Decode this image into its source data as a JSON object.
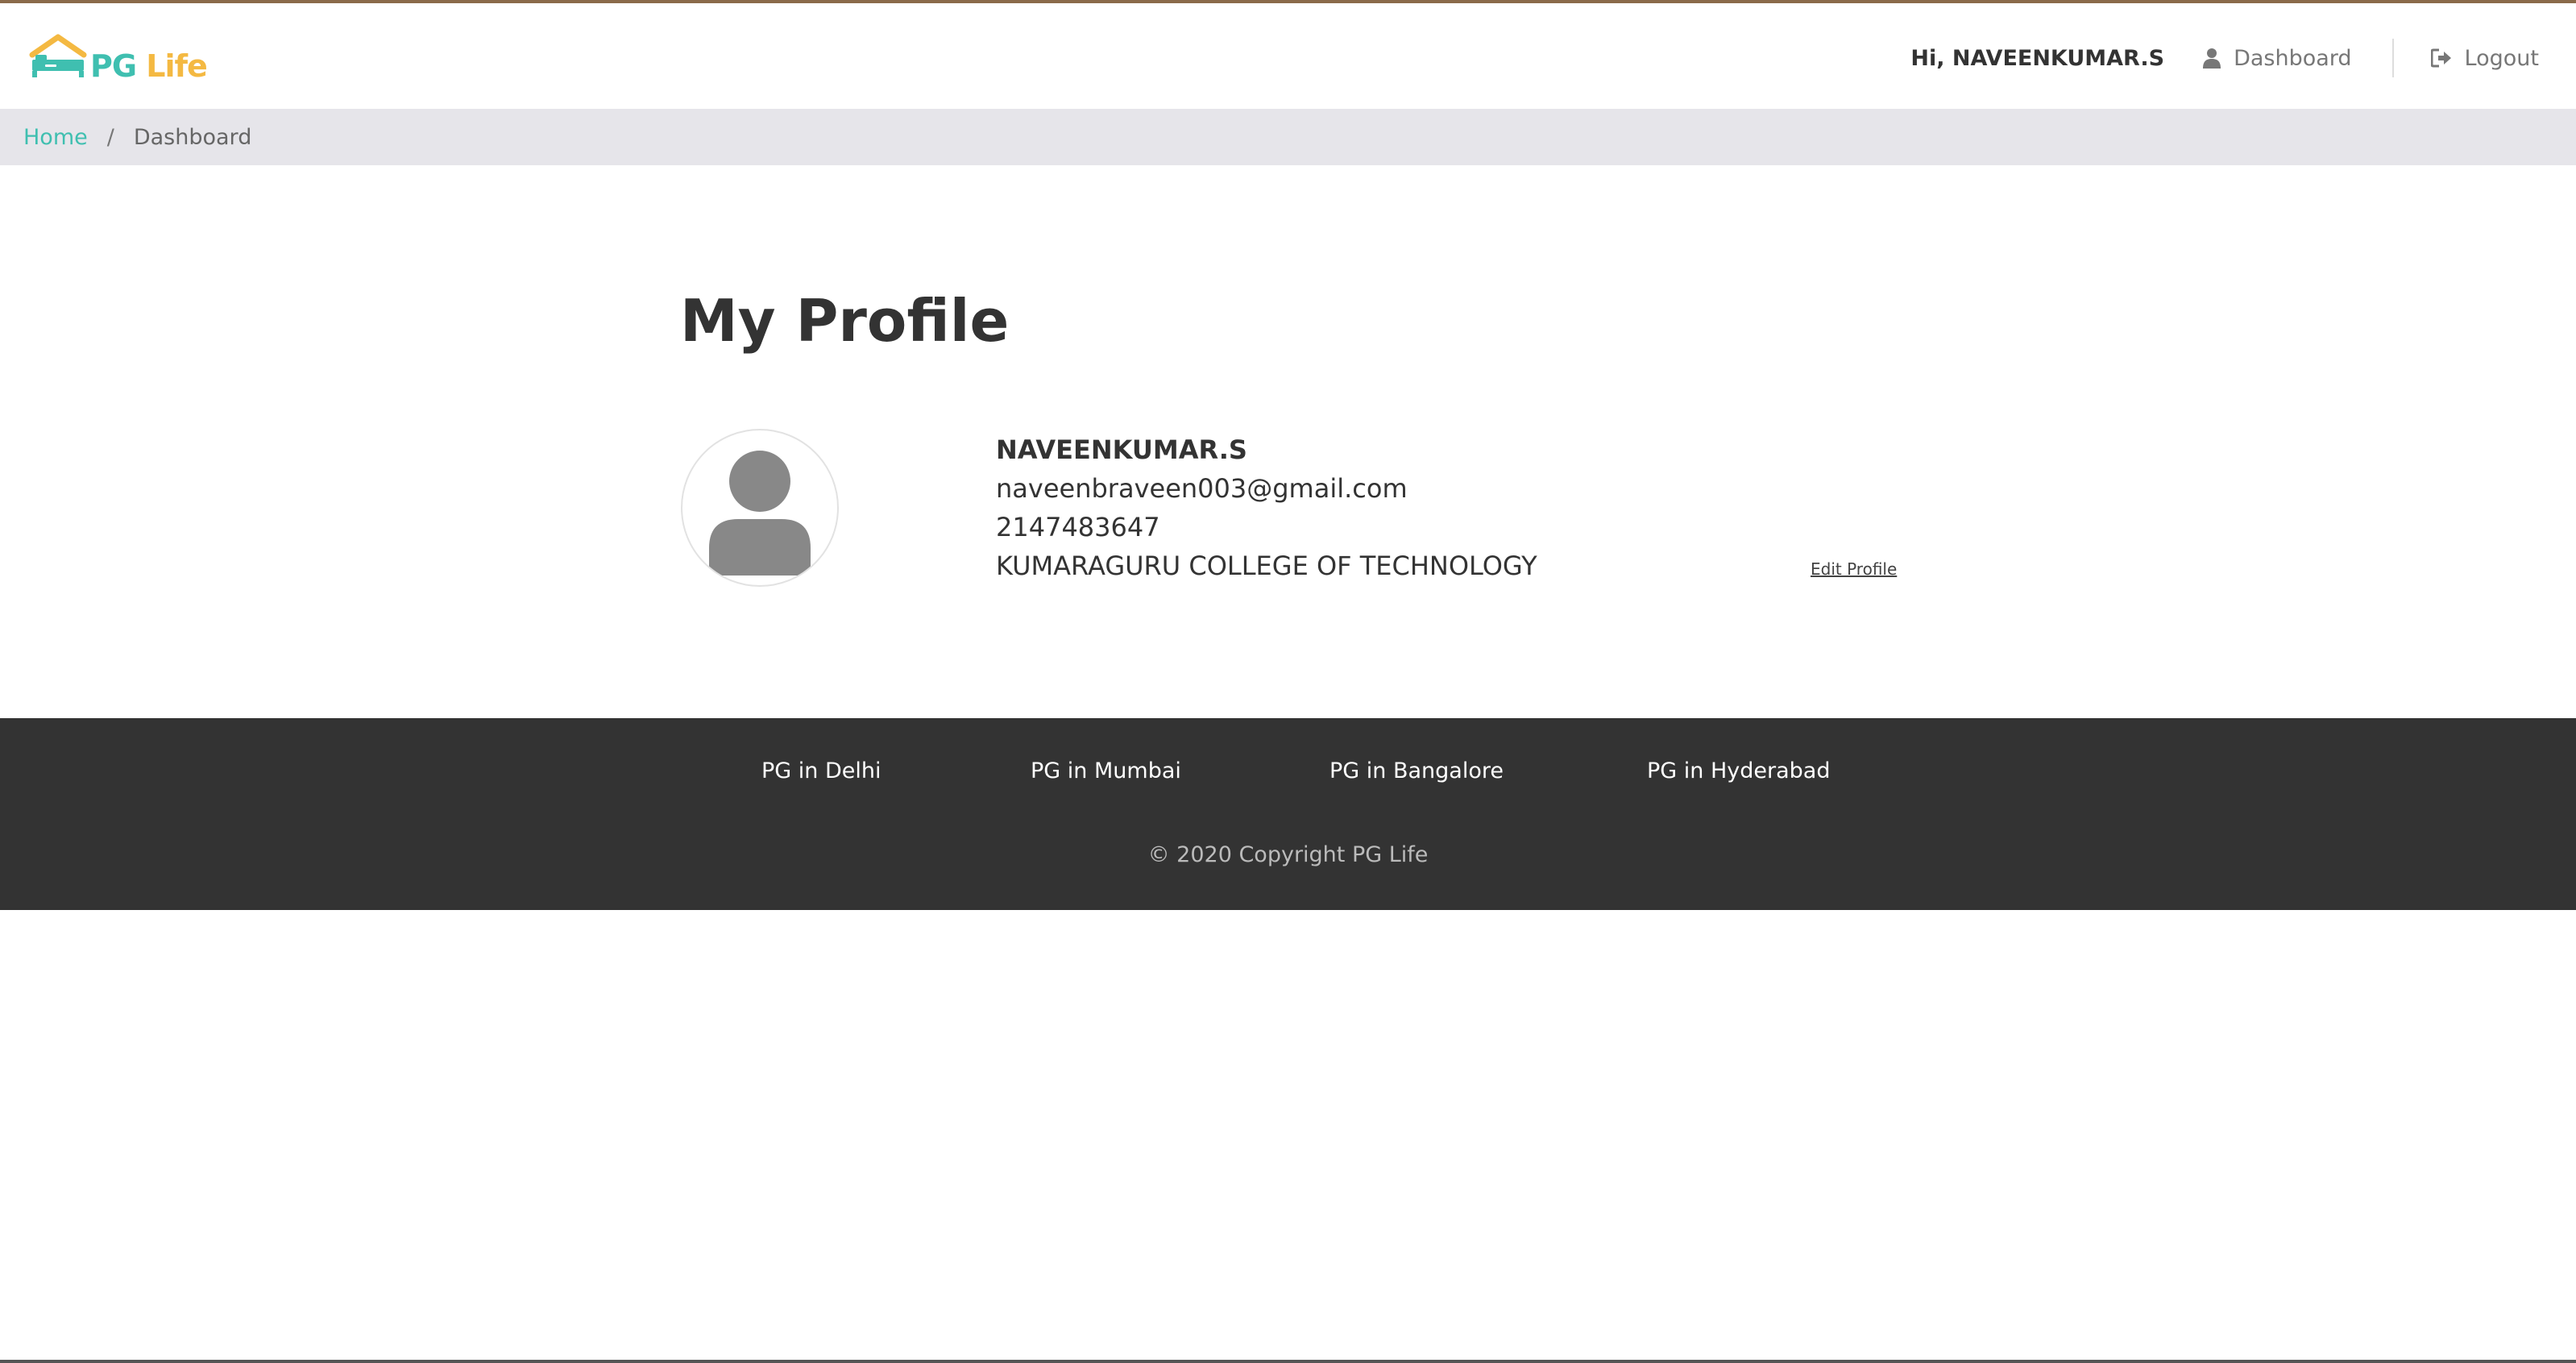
{
  "brand": {
    "logo_text_pg": "PG",
    "logo_text_life": "Life",
    "logo_icon": "house-bed-icon",
    "colors": {
      "teal": "#3fbfb0",
      "yellow": "#f4b942"
    }
  },
  "nav": {
    "greeting": "Hi, NAVEENKUMAR.S",
    "dashboard_label": "Dashboard",
    "dashboard_icon": "user-icon",
    "logout_label": "Logout",
    "logout_icon": "sign-out-icon"
  },
  "breadcrumb": {
    "home": "Home",
    "separator": "/",
    "current": "Dashboard"
  },
  "main": {
    "title": "My Profile",
    "avatar_icon": "user-avatar-icon",
    "profile": {
      "name": "NAVEENKUMAR.S",
      "email": "naveenbraveen003@gmail.com",
      "phone": "2147483647",
      "college": "KUMARAGURU COLLEGE OF TECHNOLOGY"
    },
    "edit_profile_label": "Edit Profile"
  },
  "footer": {
    "links": [
      "PG in Delhi",
      "PG in Mumbai",
      "PG in Bangalore",
      "PG in Hyderabad"
    ],
    "copyright": "© 2020 Copyright PG Life"
  }
}
